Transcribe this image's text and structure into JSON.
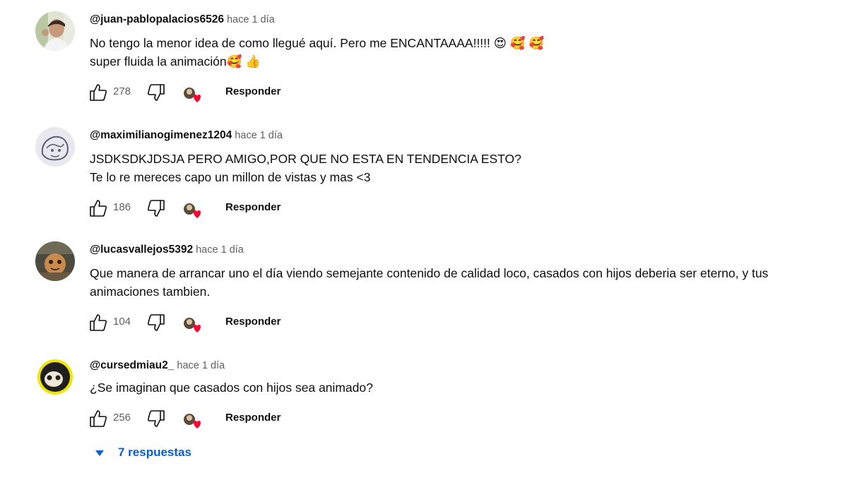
{
  "comments": [
    {
      "author": "@juan-pablopalacios6526",
      "time": "hace 1 día",
      "lines": [
        "No tengo la menor idea de como llegué aquí. Pero me ENCANTAAAA!!!!! 😍 🥰 🥰",
        " super fluida la animación🥰 👍"
      ],
      "likes": "278",
      "reply_label": "Responder"
    },
    {
      "author": "@maximilianogimenez1204",
      "time": "hace 1 día",
      "lines": [
        "JSDKSDKJDSJA PERO AMIGO,POR QUE NO ESTA EN TENDENCIA ESTO?",
        "Te lo re mereces capo un millon de vistas y mas <3"
      ],
      "likes": "186",
      "reply_label": "Responder"
    },
    {
      "author": "@lucasvallejos5392",
      "time": "hace 1 día",
      "lines": [
        "Que manera de arrancar uno el día viendo semejante contenido de calidad loco, casados con hijos deberia ser eterno, y tus",
        "animaciones tambien."
      ],
      "likes": "104",
      "reply_label": "Responder"
    },
    {
      "author": "@cursedmiau2_",
      "time": "hace 1 día",
      "lines": [
        "¿Se imaginan que casados con hijos sea animado?"
      ],
      "likes": "256",
      "reply_label": "Responder"
    }
  ],
  "replies_toggle": {
    "label": "7 respuestas"
  },
  "colors": {
    "link_blue": "#065fd4",
    "secondary_text": "#606060",
    "heart_red": "#ff0033"
  },
  "icons": [
    "thumb-up-icon",
    "thumb-down-icon",
    "creator-heart-icon",
    "caret-down-icon"
  ]
}
